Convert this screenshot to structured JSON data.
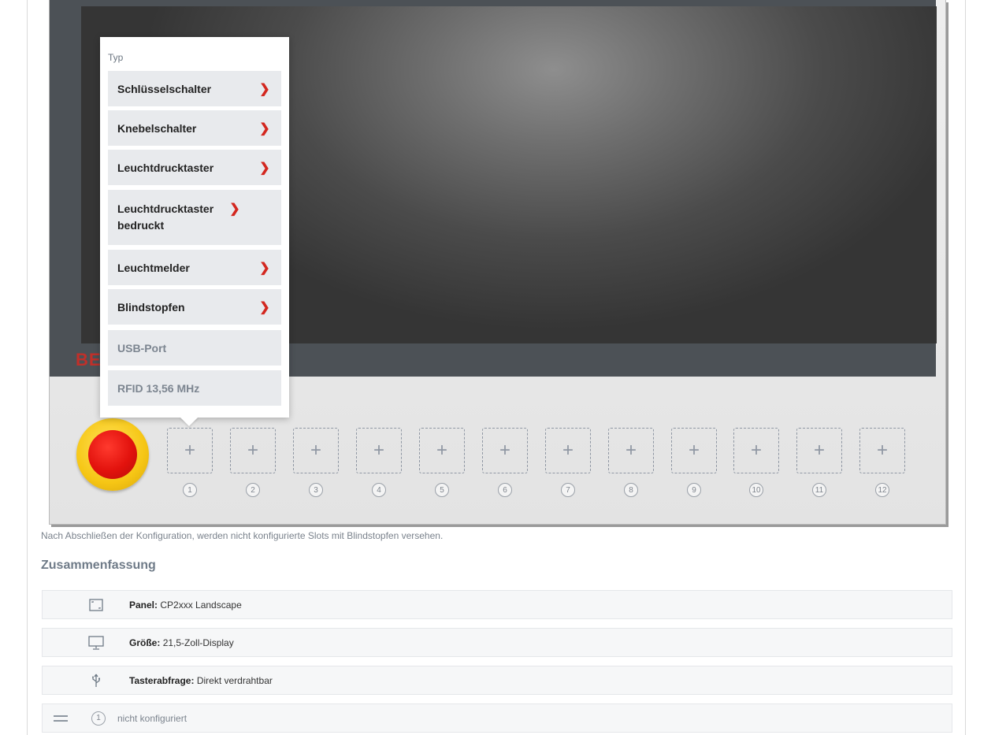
{
  "device": {
    "logo_text": "BE",
    "slots": [
      {
        "number": "1",
        "icon": "plus-icon"
      },
      {
        "number": "2",
        "icon": "plus-icon"
      },
      {
        "number": "3",
        "icon": "plus-icon"
      },
      {
        "number": "4",
        "icon": "plus-icon"
      },
      {
        "number": "5",
        "icon": "plus-icon"
      },
      {
        "number": "6",
        "icon": "plus-icon"
      },
      {
        "number": "7",
        "icon": "plus-icon"
      },
      {
        "number": "8",
        "icon": "plus-icon"
      },
      {
        "number": "9",
        "icon": "plus-icon"
      },
      {
        "number": "10",
        "icon": "plus-icon"
      },
      {
        "number": "11",
        "icon": "plus-icon"
      },
      {
        "number": "12",
        "icon": "plus-icon"
      }
    ],
    "plus_glyph": "+"
  },
  "popup": {
    "title": "Typ",
    "items": [
      {
        "label": "Schlüsselschalter",
        "enabled": true
      },
      {
        "label": "Knebelschalter",
        "enabled": true
      },
      {
        "label": "Leuchtdrucktaster",
        "enabled": true
      },
      {
        "label": "Leuchtdrucktaster bedruckt",
        "enabled": true
      },
      {
        "label": "Leuchtmelder",
        "enabled": true
      },
      {
        "label": "Blindstopfen",
        "enabled": true
      },
      {
        "label": "USB-Port",
        "enabled": false
      },
      {
        "label": "RFID 13,56 MHz",
        "enabled": false
      }
    ],
    "chevron_glyph": "❯"
  },
  "note": "Nach Abschließen der Konfiguration, werden nicht konfigurierte Slots mit Blindstopfen versehen.",
  "summary": {
    "title": "Zusammenfassung",
    "rows": [
      {
        "icon": "panel-icon",
        "key": "Panel:",
        "value": "CP2xxx Landscape"
      },
      {
        "icon": "monitor-icon",
        "key": "Größe:",
        "value": "21,5-Zoll-Display"
      },
      {
        "icon": "usb-icon",
        "key": "Tasterabfrage:",
        "value": "Direkt verdrahtbar"
      }
    ],
    "slot_row": {
      "number": "1",
      "status": "nicht konfiguriert"
    }
  },
  "colors": {
    "accent_red": "#d3271f",
    "estop_yellow": "#f6c615",
    "estop_red": "#e2120d",
    "bezel": "#4c5156"
  }
}
